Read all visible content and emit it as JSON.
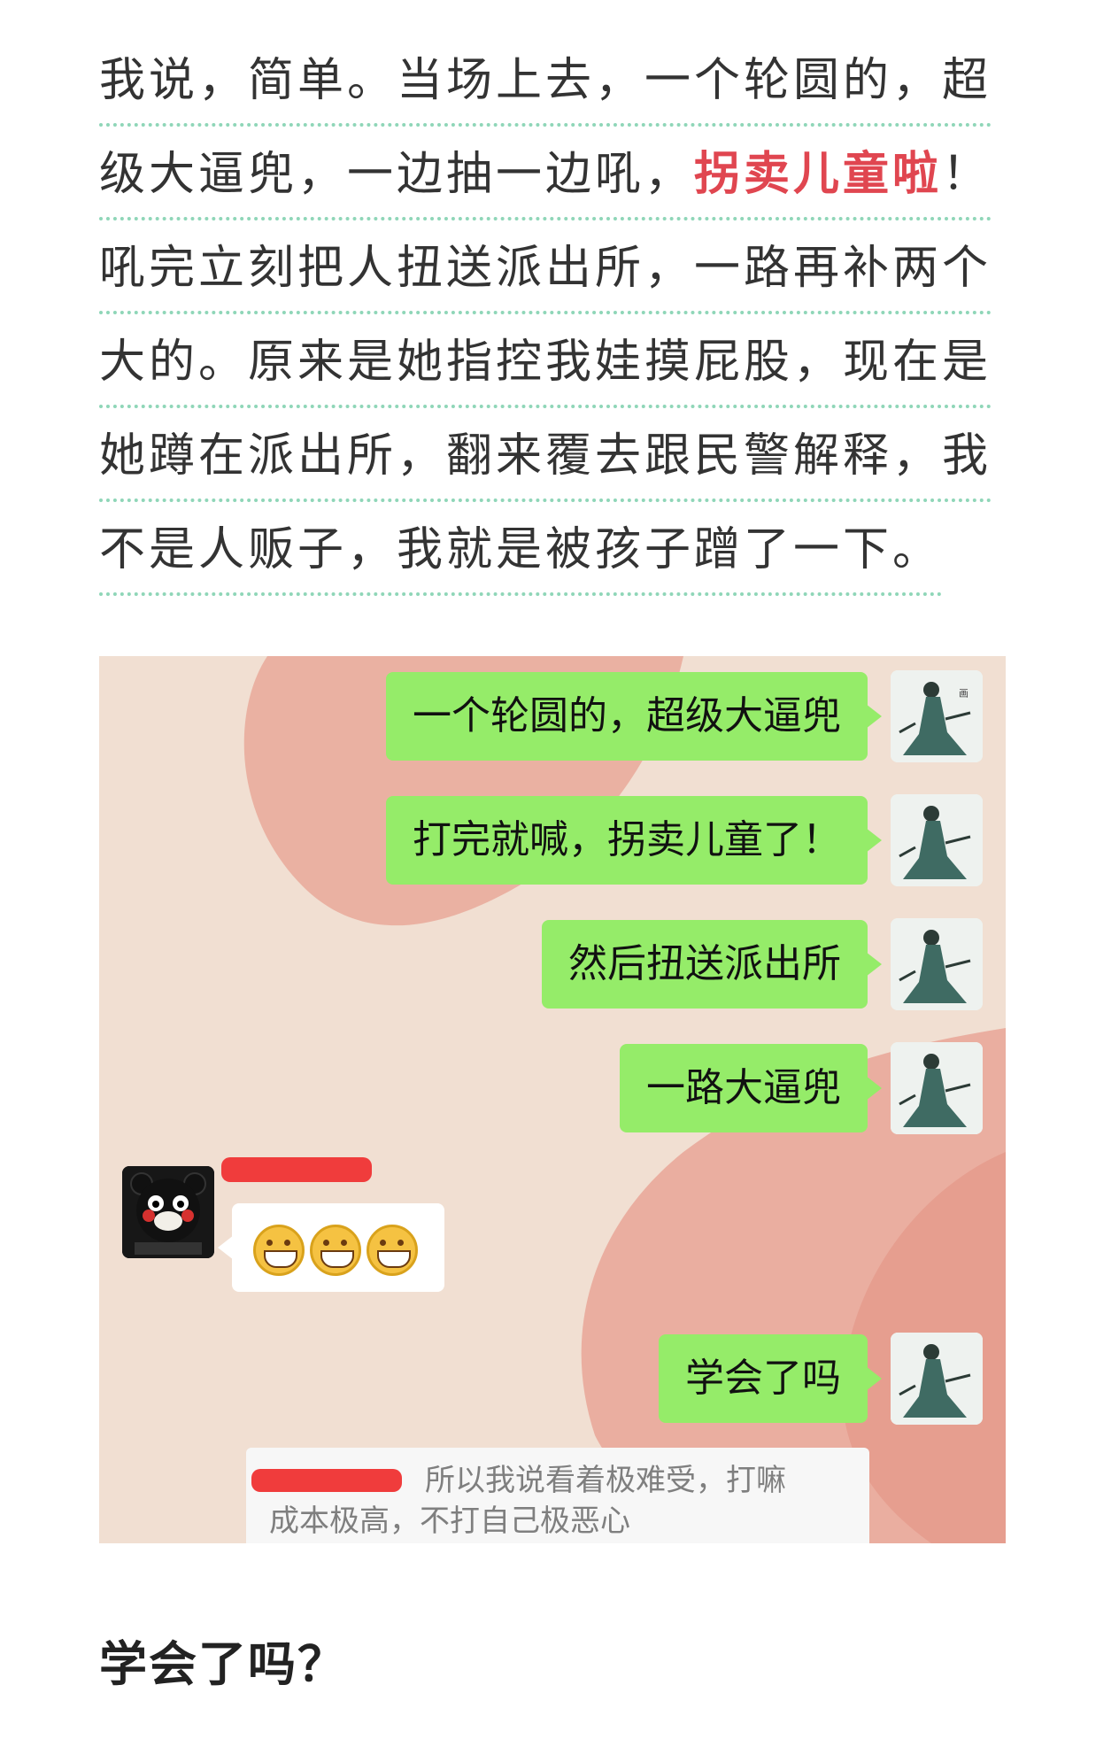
{
  "article": {
    "lines": [
      {
        "text": "我说，简单。当场上去，一个轮圆的，超"
      },
      {
        "pre": "级大逼兜，一边抽一边吼，",
        "highlight": "拐卖儿童啦",
        "post": "！"
      },
      {
        "text": "吼完立刻把人扭送派出所，一路再补两个"
      },
      {
        "text": "大的。原来是她指控我娃摸屁股，现在是"
      },
      {
        "text": "她蹲在派出所，翻来覆去跟民警解释，我"
      },
      {
        "text": "不是人贩子，我就是被孩子蹭了一下。"
      }
    ],
    "highlight_color": "#e04650"
  },
  "chat": {
    "self_messages": [
      "一个轮圆的，超级大逼兜",
      "打完就喊，拐卖儿童了！",
      "然后扭送派出所",
      "一路大逼兜"
    ],
    "other_reply": {
      "emoji_name": "grin-emoji",
      "emoji_count": 3
    },
    "self_last": "学会了吗",
    "quote_text_line1": "所以我说看着极难受，打嘛",
    "quote_text_line2": "成本极高，不打自己极恶心",
    "bubble_color": "#95ec69"
  },
  "subheading": "学会了吗？"
}
